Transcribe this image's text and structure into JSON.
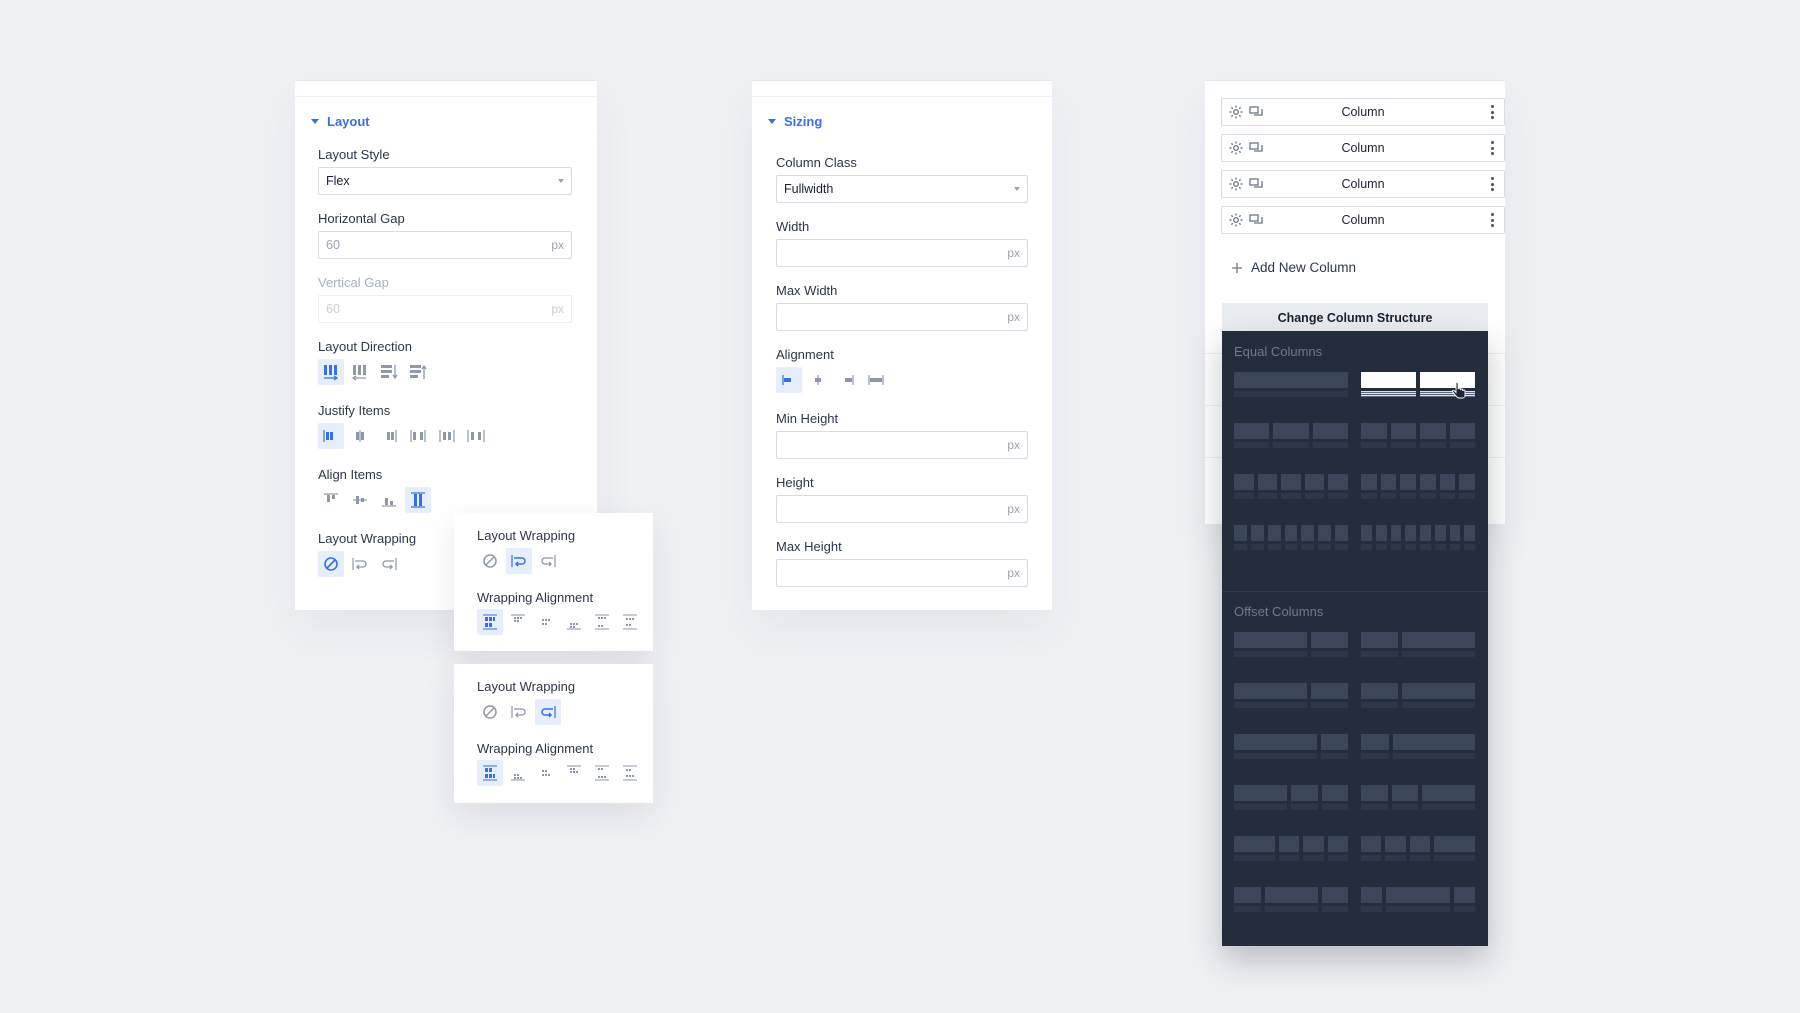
{
  "layout_panel": {
    "section_title": "Layout",
    "layout_style": {
      "label": "Layout Style",
      "value": "Flex"
    },
    "horizontal_gap": {
      "label": "Horizontal Gap",
      "value": "60",
      "unit": "px"
    },
    "vertical_gap": {
      "label": "Vertical Gap",
      "value": "60",
      "unit": "px"
    },
    "layout_direction": {
      "label": "Layout Direction"
    },
    "justify_items": {
      "label": "Justify Items"
    },
    "align_items": {
      "label": "Align Items"
    },
    "layout_wrapping": {
      "label": "Layout Wrapping"
    }
  },
  "wrap_popup_1": {
    "layout_wrapping_label": "Layout Wrapping",
    "wrapping_alignment_label": "Wrapping Alignment"
  },
  "wrap_popup_2": {
    "layout_wrapping_label": "Layout Wrapping",
    "wrapping_alignment_label": "Wrapping Alignment"
  },
  "sizing_panel": {
    "section_title": "Sizing",
    "column_class": {
      "label": "Column Class",
      "value": "Fullwidth"
    },
    "width": {
      "label": "Width",
      "unit": "px"
    },
    "max_width": {
      "label": "Max Width",
      "unit": "px"
    },
    "alignment": {
      "label": "Alignment"
    },
    "min_height": {
      "label": "Min Height",
      "unit": "px"
    },
    "height": {
      "label": "Height",
      "unit": "px"
    },
    "max_height": {
      "label": "Max Height",
      "unit": "px"
    }
  },
  "columns_panel": {
    "columns": [
      "Column",
      "Column",
      "Column",
      "Column"
    ],
    "add_new_column": "Add New Column",
    "change_structure": "Change Column Structure",
    "equal_columns_title": "Equal Columns",
    "offset_columns_title": "Offset Columns"
  },
  "colors": {
    "accent": "#3a6fe0",
    "background": "#f0f1f5",
    "dark_panel": "#232d3c"
  }
}
